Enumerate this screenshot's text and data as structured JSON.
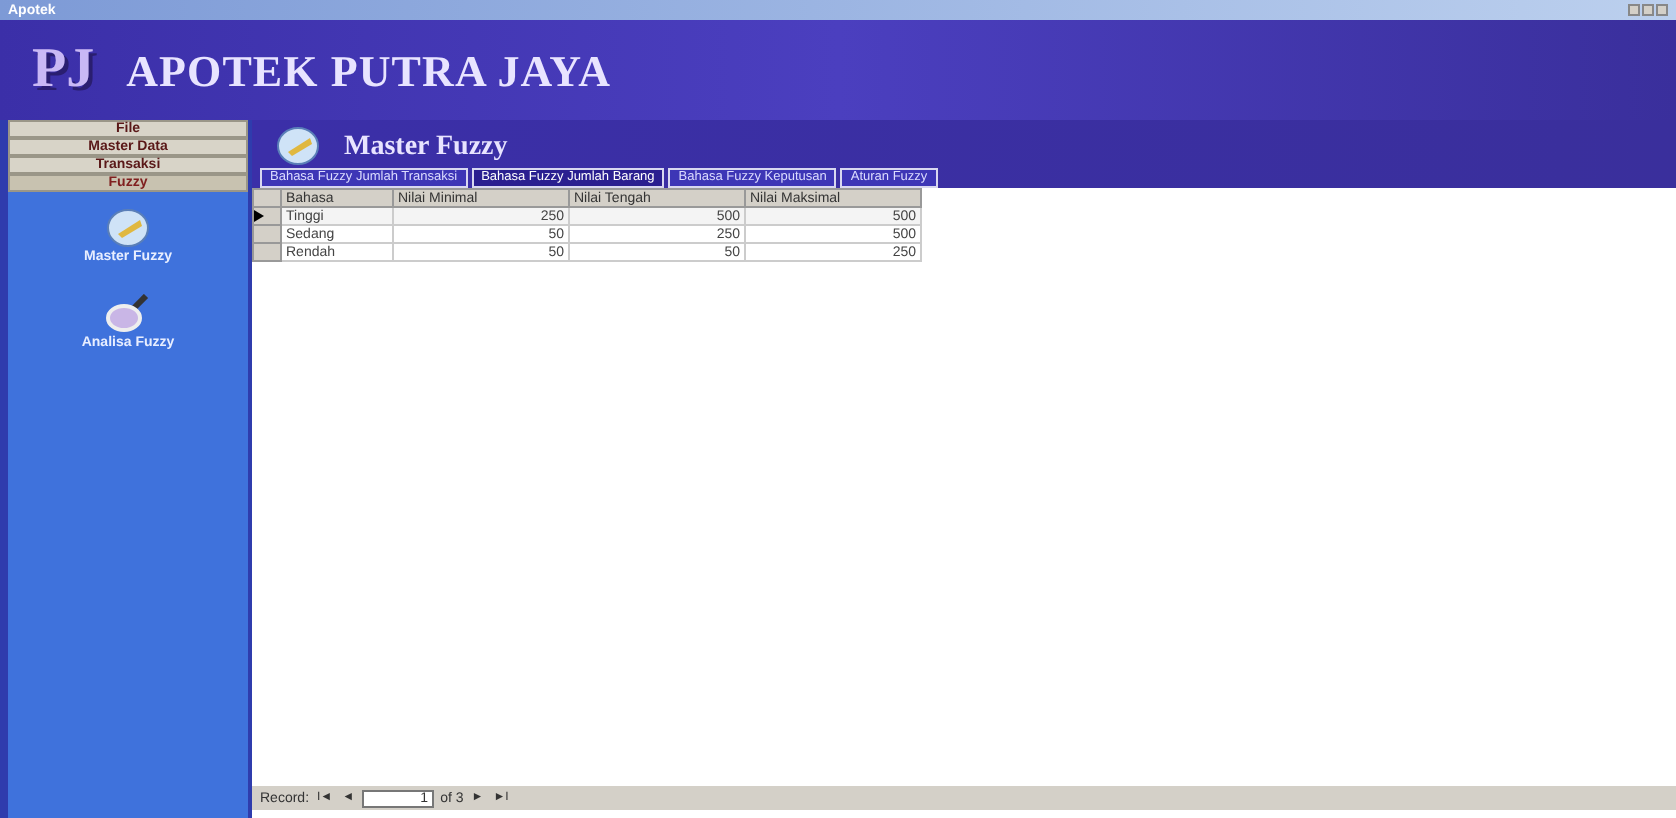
{
  "window": {
    "title": "Apotek"
  },
  "header": {
    "logo": "PJ",
    "title": "APOTEK PUTRA JAYA"
  },
  "menu": [
    {
      "label": "File",
      "selected": false
    },
    {
      "label": "Master Data",
      "selected": false
    },
    {
      "label": "Transaksi",
      "selected": false
    },
    {
      "label": "Fuzzy",
      "selected": true
    }
  ],
  "sidebar": {
    "items": [
      {
        "label": "Master Fuzzy",
        "kind": "disc"
      },
      {
        "label": "Analisa Fuzzy",
        "kind": "magnifier"
      }
    ]
  },
  "page_title": "Master Fuzzy",
  "tabs": [
    {
      "label": "Bahasa Fuzzy Jumlah Transaksi",
      "selected": false
    },
    {
      "label": "Bahasa Fuzzy Jumlah Barang",
      "selected": true
    },
    {
      "label": "Bahasa Fuzzy Keputusan",
      "selected": false
    },
    {
      "label": "Aturan Fuzzy",
      "selected": false
    }
  ],
  "table": {
    "columns": [
      "Bahasa",
      "Nilai Minimal",
      "Nilai Tengah",
      "Nilai Maksimal"
    ],
    "rows": [
      {
        "cells": [
          "Tinggi",
          "250",
          "500",
          "500"
        ],
        "selected": true
      },
      {
        "cells": [
          "Sedang",
          "50",
          "250",
          "500"
        ],
        "selected": false
      },
      {
        "cells": [
          "Rendah",
          "50",
          "50",
          "250"
        ],
        "selected": false
      }
    ]
  },
  "record_nav": {
    "label": "Record:",
    "first": "I◄",
    "prev": "◄",
    "current": "1",
    "total": "of 3",
    "next": "►",
    "last": "►I"
  }
}
